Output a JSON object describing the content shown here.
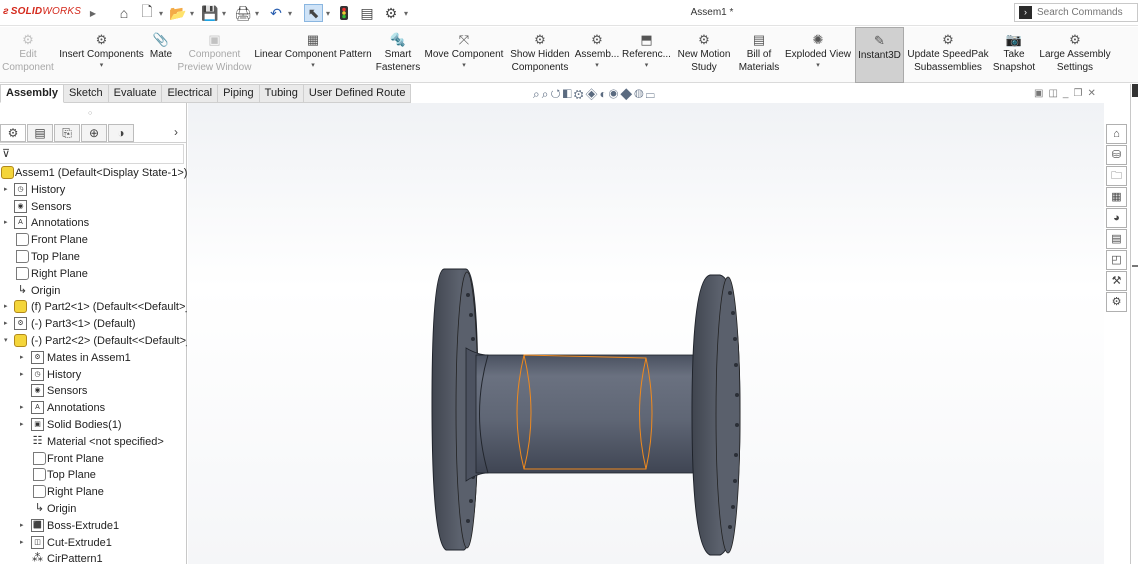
{
  "app": {
    "logo_prefix": "SOLID",
    "logo_suffix": "WORKS",
    "document_title": "Assem1 *"
  },
  "search": {
    "placeholder": "Search Commands"
  },
  "ribbon": {
    "edit_component": {
      "line1": "Edit",
      "line2": "Component"
    },
    "insert_components": {
      "line1": "Insert Components"
    },
    "mate": {
      "line1": "Mate"
    },
    "component_preview": {
      "line1": "Component",
      "line2": "Preview Window"
    },
    "linear_pattern": {
      "line1": "Linear Component Pattern"
    },
    "smart_fasteners": {
      "line1": "Smart",
      "line2": "Fasteners"
    },
    "move_component": {
      "line1": "Move Component"
    },
    "show_hidden": {
      "line1": "Show Hidden",
      "line2": "Components"
    },
    "assembly_features": {
      "line1": "Assemb..."
    },
    "reference_geometry": {
      "line1": "Referenc..."
    },
    "new_motion_study": {
      "line1": "New Motion",
      "line2": "Study"
    },
    "bill_of_materials": {
      "line1": "Bill of",
      "line2": "Materials"
    },
    "exploded_view": {
      "line1": "Exploded View"
    },
    "instant3d": {
      "line1": "Instant3D"
    },
    "speedpak": {
      "line1": "Update SpeedPak",
      "line2": "Subassemblies"
    },
    "take_snapshot": {
      "line1": "Take",
      "line2": "Snapshot"
    },
    "large_assembly": {
      "line1": "Large Assembly",
      "line2": "Settings"
    }
  },
  "tabs": [
    "Assembly",
    "Sketch",
    "Evaluate",
    "Electrical",
    "Piping",
    "Tubing",
    "User Defined Route"
  ],
  "tree": {
    "root": "Assem1  (Default<Display State-1>)",
    "items": [
      "History",
      "Sensors",
      "Annotations",
      "Front Plane",
      "Top Plane",
      "Right Plane",
      "Origin",
      "(f) Part2<1> (Default<<Default>_",
      "(-) Part3<1> (Default)",
      "(-) Part2<2> (Default<<Default>_",
      "Mates in Assem1",
      "History",
      "Sensors",
      "Annotations",
      "Solid Bodies(1)",
      "Material <not specified>",
      "Front Plane",
      "Top Plane",
      "Right Plane",
      "Origin",
      "Boss-Extrude1",
      "Cut-Extrude1",
      "CirPattern1"
    ]
  },
  "colors": {
    "accent": "#d4291c",
    "highlight_edge": "#f08a1e",
    "part_body": "#5d6574"
  },
  "icons": {
    "quick_access": [
      "home-icon",
      "new-file-icon",
      "open-icon",
      "save-icon",
      "print-icon",
      "undo-icon",
      "select-icon",
      "rebuild-icon",
      "file-properties-icon",
      "options-icon"
    ],
    "right_taskpane": [
      "home-icon",
      "parts-library-icon",
      "file-explorer-icon",
      "view-palette-icon",
      "appearances-icon",
      "custom-properties-icon",
      "forum-icon",
      "toolbox-icon",
      "solidworks-resources-icon"
    ]
  }
}
